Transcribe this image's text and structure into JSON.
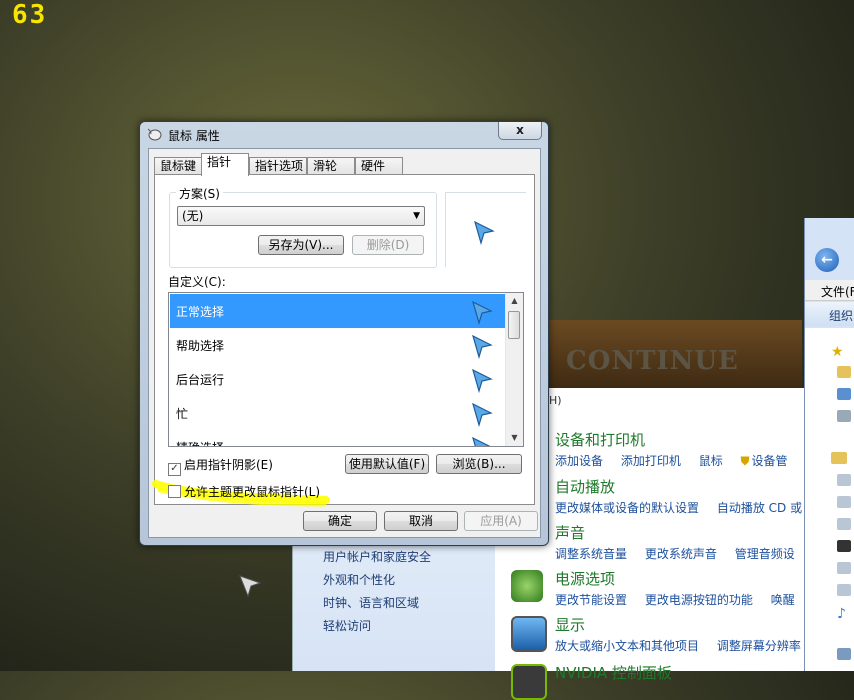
{
  "overlay": {
    "badge": "63"
  },
  "wallpaper": {
    "text": "CONTINUE"
  },
  "dialog": {
    "title": "鼠标 属性",
    "close_label": "x",
    "tabs": [
      {
        "label": "鼠标键"
      },
      {
        "label": "指针"
      },
      {
        "label": "指针选项"
      },
      {
        "label": "滑轮"
      },
      {
        "label": "硬件"
      }
    ],
    "active_tab": "指针",
    "scheme": {
      "label": "方案(S)",
      "selected": "(无)",
      "save_as": "另存为(V)...",
      "delete": "删除(D)"
    },
    "custom_label": "自定义(C):",
    "pointers": [
      {
        "label": "正常选择",
        "selected": true
      },
      {
        "label": "帮助选择",
        "selected": false
      },
      {
        "label": "后台运行",
        "selected": false
      },
      {
        "label": "忙",
        "selected": false
      },
      {
        "label": "精确选择",
        "selected": false
      }
    ],
    "shadow_checkbox": {
      "label": "启用指针阴影(E)",
      "checked": true
    },
    "use_default": "使用默认值(F)",
    "browse": "浏览(B)...",
    "theme_checkbox": {
      "label": "允许主题更改鼠标指针(L)",
      "checked": false
    },
    "buttons": {
      "ok": "确定",
      "cancel": "取消",
      "apply": "应用(A)"
    }
  },
  "control_panel": {
    "menu_fragment": "H)",
    "left_links": [
      "用户帐户和家庭安全",
      "外观和个性化",
      "时钟、语言和区域",
      "轻松访问"
    ],
    "categories": [
      {
        "title": "设备和打印机",
        "links": [
          "添加设备",
          "添加打印机",
          "鼠标",
          "设备管"
        ]
      },
      {
        "title": "自动播放",
        "links": [
          "更改媒体或设备的默认设置",
          "自动播放 CD 或"
        ]
      },
      {
        "title": "声音",
        "links": [
          "调整系统音量",
          "更改系统声音",
          "管理音频设"
        ]
      },
      {
        "title": "电源选项",
        "links": [
          "更改节能设置",
          "更改电源按钮的功能",
          "唤醒"
        ]
      },
      {
        "title": "显示",
        "links": [
          "放大或缩小文本和其他项目",
          "调整屏幕分辨率"
        ]
      },
      {
        "title": "NVIDIA 控制面板",
        "links": []
      }
    ]
  },
  "explorer": {
    "menu_file": "文件(F",
    "toolbar_organize": "组织"
  },
  "colors": {
    "selection": "#3399ff",
    "highlighter": "#ffff00",
    "link": "#1c4f9c",
    "category": "#1e7a2a"
  }
}
